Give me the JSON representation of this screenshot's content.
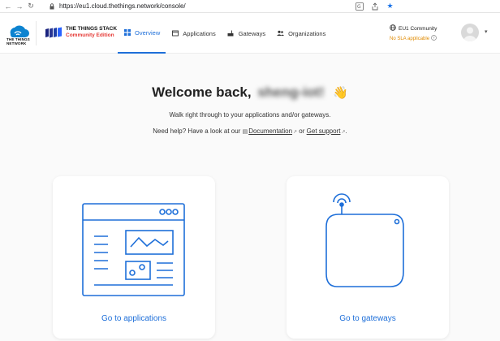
{
  "browser": {
    "url": "https://eu1.cloud.thethings.network/console/"
  },
  "header": {
    "ttn_logo_text": "THE THINGS NETWORK",
    "product_title": "THE THINGS STACK",
    "product_edition": "Community Edition",
    "nav": [
      {
        "label": "Overview",
        "icon": "grid-icon",
        "active": true
      },
      {
        "label": "Applications",
        "icon": "application-icon",
        "active": false
      },
      {
        "label": "Gateways",
        "icon": "gateway-icon",
        "active": false
      },
      {
        "label": "Organizations",
        "icon": "people-icon",
        "active": false
      }
    ],
    "cluster_name": "EU1 Community",
    "cluster_sla": "No SLA applicable"
  },
  "main": {
    "welcome_prefix": "Welcome back,",
    "username": "sheng-iot!",
    "welcome_emoji": "👋",
    "subtitle": "Walk right through to your applications and/or gateways.",
    "help_prefix": "Need help? Have a look at our",
    "documentation_link": "Documentation",
    "help_or": "or",
    "support_link": "Get support",
    "help_suffix": ".",
    "cards": [
      {
        "label": "Go to applications"
      },
      {
        "label": "Go to gateways"
      }
    ]
  },
  "colors": {
    "accent": "#1e6fd9",
    "edition_red": "#e53935",
    "sla_orange": "#e08a00"
  }
}
